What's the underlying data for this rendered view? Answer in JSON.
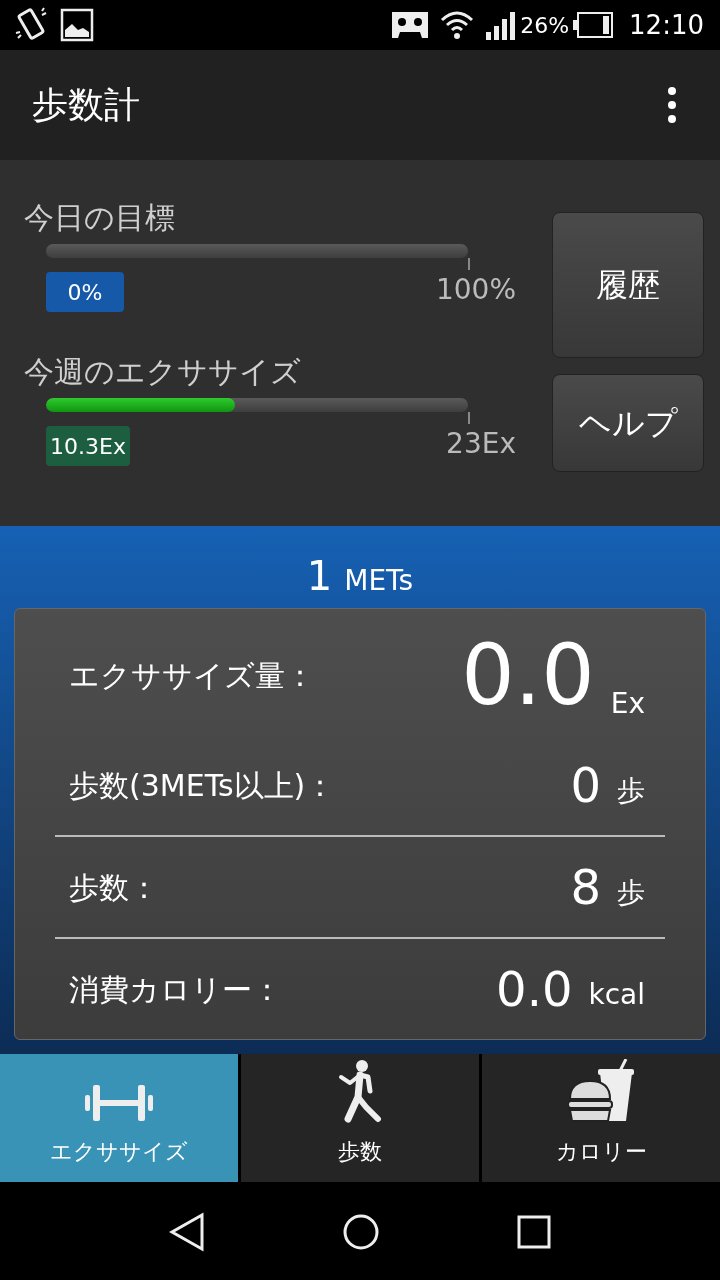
{
  "status_bar": {
    "battery": "26%",
    "time": "12:10"
  },
  "app_bar": {
    "title": "歩数計"
  },
  "goals": [
    {
      "label": "今日の目標",
      "level": 0,
      "value": "0%",
      "max": "100%",
      "color": "#1559a8"
    },
    {
      "label": "今週のエクササイズ",
      "level": 0.448,
      "value": "10.3Ex",
      "max": "23Ex",
      "color": "#1e5e40"
    }
  ],
  "side_buttons": [
    "履歴",
    "ヘルプ"
  ],
  "mets": {
    "value": "1",
    "unit": "METs"
  },
  "stat_groups": [
    [
      {
        "label": "エクササイズ量：",
        "value": "0.0",
        "unit": "Ex",
        "kind": "large"
      },
      {
        "label": "歩数(3METs以上)：",
        "value": "0",
        "unit": "歩",
        "kind": "normal"
      }
    ],
    [
      {
        "label": "歩数：",
        "value": "8",
        "unit": "歩",
        "kind": "normal"
      }
    ],
    [
      {
        "label": "消費カロリー：",
        "value": "0.0",
        "unit": "kcal",
        "kind": "normal"
      }
    ]
  ],
  "tabs": [
    {
      "label": "エクササイズ",
      "kind": "dumbbell",
      "selected": true
    },
    {
      "label": "歩数",
      "kind": "walker",
      "selected": false
    },
    {
      "label": "カロリー",
      "kind": "burger",
      "selected": false
    }
  ]
}
